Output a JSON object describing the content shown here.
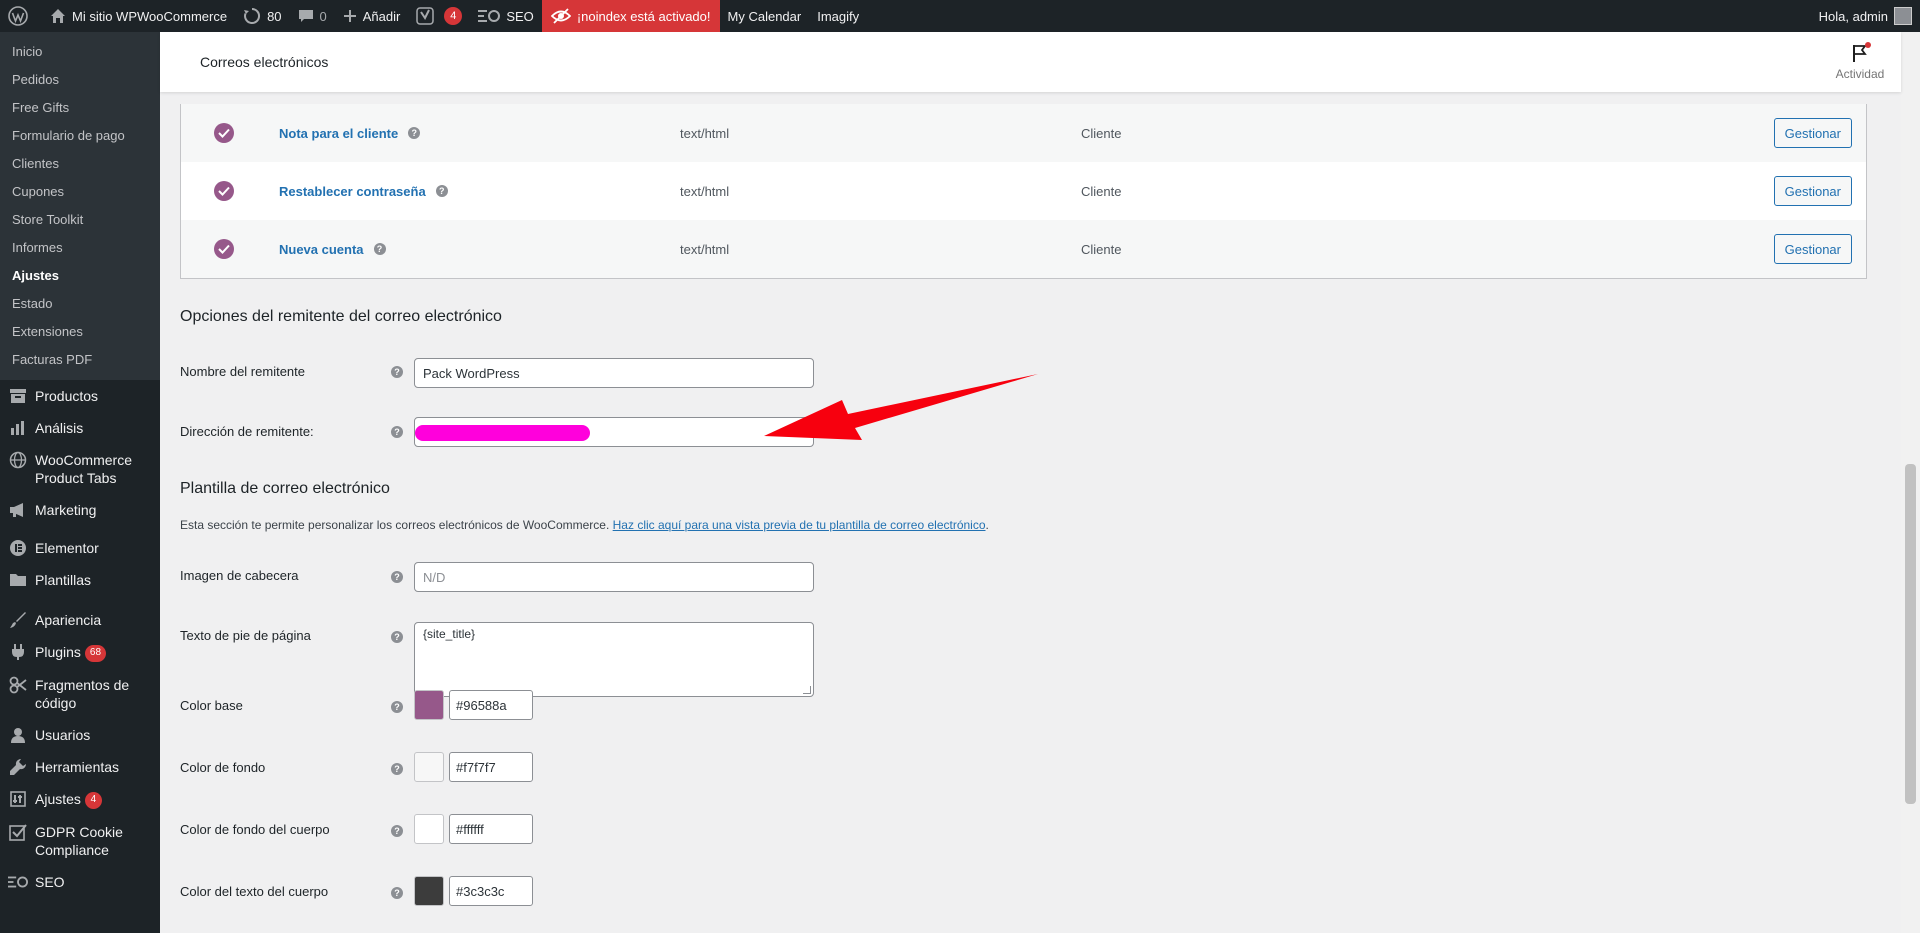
{
  "adminbar": {
    "site_name": "Mi sitio WPWooCommerce",
    "updates_count": "80",
    "comments_count": "0",
    "add_new": "Añadir",
    "yoast_badge": "4",
    "seo": "SEO",
    "noindex": "¡noindex está activado!",
    "calendar": "My Calendar",
    "imagify": "Imagify",
    "greeting": "Hola, admin"
  },
  "sidebar": {
    "submenu": [
      "Inicio",
      "Pedidos",
      "Free Gifts",
      "Formulario de pago",
      "Clientes",
      "Cupones",
      "Store Toolkit",
      "Informes",
      "Ajustes",
      "Estado",
      "Extensiones",
      "Facturas PDF"
    ],
    "current_submenu": "Ajustes",
    "menu": {
      "productos": "Productos",
      "analisis": "Análisis",
      "product_tabs": "WooCommerce Product Tabs",
      "marketing": "Marketing",
      "elementor": "Elementor",
      "plantillas": "Plantillas",
      "apariencia": "Apariencia",
      "plugins": "Plugins",
      "plugins_badge": "68",
      "fragmentos": "Fragmentos de código",
      "usuarios": "Usuarios",
      "herramientas": "Herramientas",
      "ajustes": "Ajustes",
      "ajustes_badge": "4",
      "gdpr": "GDPR Cookie Compliance",
      "seo": "SEO"
    }
  },
  "header": {
    "title": "Correos electrónicos",
    "activity": "Actividad"
  },
  "email_rows": [
    {
      "name": "Nota para el cliente",
      "content_type": "text/html",
      "recipient": "Cliente",
      "action": "Gestionar"
    },
    {
      "name": "Restablecer contraseña",
      "content_type": "text/html",
      "recipient": "Cliente",
      "action": "Gestionar"
    },
    {
      "name": "Nueva cuenta",
      "content_type": "text/html",
      "recipient": "Cliente",
      "action": "Gestionar"
    }
  ],
  "sender": {
    "section_title": "Opciones del remitente del correo electrónico",
    "name_label": "Nombre del remitente",
    "name_value": "Pack WordPress",
    "address_label": "Dirección de remitente:"
  },
  "template": {
    "section_title": "Plantilla de correo electrónico",
    "description": "Esta sección te permite personalizar los correos electrónicos de WooCommerce.",
    "preview_link": "Haz clic aquí para una vista previa de tu plantilla de correo electrónico",
    "header_image_label": "Imagen de cabecera",
    "header_image_placeholder": "N/D",
    "footer_label": "Texto de pie de página",
    "footer_value": "{site_title}",
    "colors": [
      {
        "label": "Color base",
        "value": "#96588a",
        "swatch": "#96588a"
      },
      {
        "label": "Color de fondo",
        "value": "#f7f7f7",
        "swatch": "#f7f7f7"
      },
      {
        "label": "Color de fondo del cuerpo",
        "value": "#ffffff",
        "swatch": "#ffffff"
      },
      {
        "label": "Color del texto del cuerpo",
        "value": "#3c3c3c",
        "swatch": "#3c3c3c"
      }
    ]
  },
  "help_glyph": "?",
  "period": "."
}
